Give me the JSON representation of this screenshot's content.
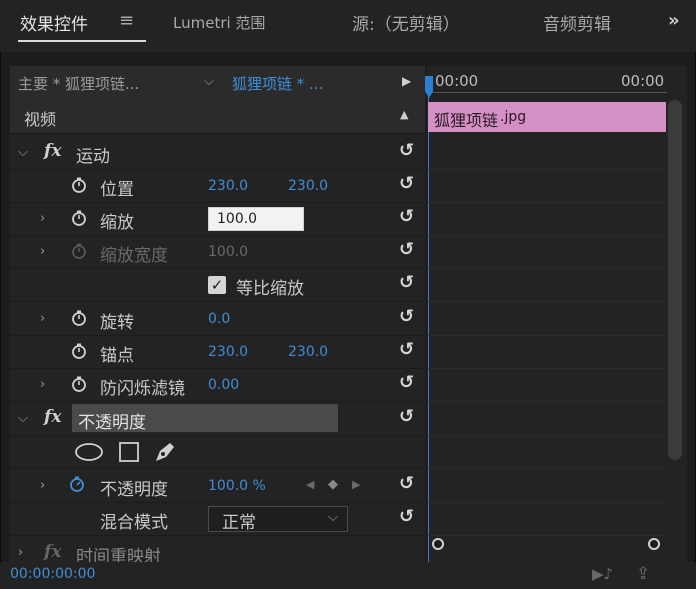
{
  "tabs": [
    {
      "label": "效果控件"
    },
    {
      "label": "Lumetri 范围"
    },
    {
      "label": "源:（无剪辑）"
    },
    {
      "label": "音频剪辑"
    }
  ],
  "tab_menu_glyph": "≡",
  "overflow_glyph": "»",
  "source": {
    "master": "主要 * 狐狸项链...",
    "sequence": "狐狸项链 * ..."
  },
  "timeline": {
    "time_start": "00:00",
    "time_end": "00:00",
    "clip_name": "狐狸项链",
    "clip_ext": ".jpg"
  },
  "section": {
    "video": "视频"
  },
  "motion": {
    "label": "运动",
    "position": {
      "label": "位置",
      "x": "230.0",
      "y": "230.0"
    },
    "scale": {
      "label": "缩放",
      "value": "100.0"
    },
    "scale_width": {
      "label": "缩放宽度",
      "value": "100.0"
    },
    "uniform_scale": {
      "label": "等比缩放",
      "checked": true
    },
    "rotation": {
      "label": "旋转",
      "value": "0.0"
    },
    "anchor": {
      "label": "锚点",
      "x": "230.0",
      "y": "230.0"
    },
    "anti_flicker": {
      "label": "防闪烁滤镜",
      "value": "0.00"
    }
  },
  "opacity": {
    "header": "不透明度",
    "label": "不透明度",
    "value": "100.0 %",
    "blend_label": "混合模式",
    "blend_value": "正常"
  },
  "time_remap": {
    "label": "时间重映射"
  },
  "fx_glyph": "fx",
  "reset_glyph": "↺",
  "status": {
    "timecode": "00:00:00:00"
  },
  "colors": {
    "accent_blue": "#3f8dd9",
    "clip_pink": "#d48fc5",
    "playhead": "#2d7fd1"
  }
}
